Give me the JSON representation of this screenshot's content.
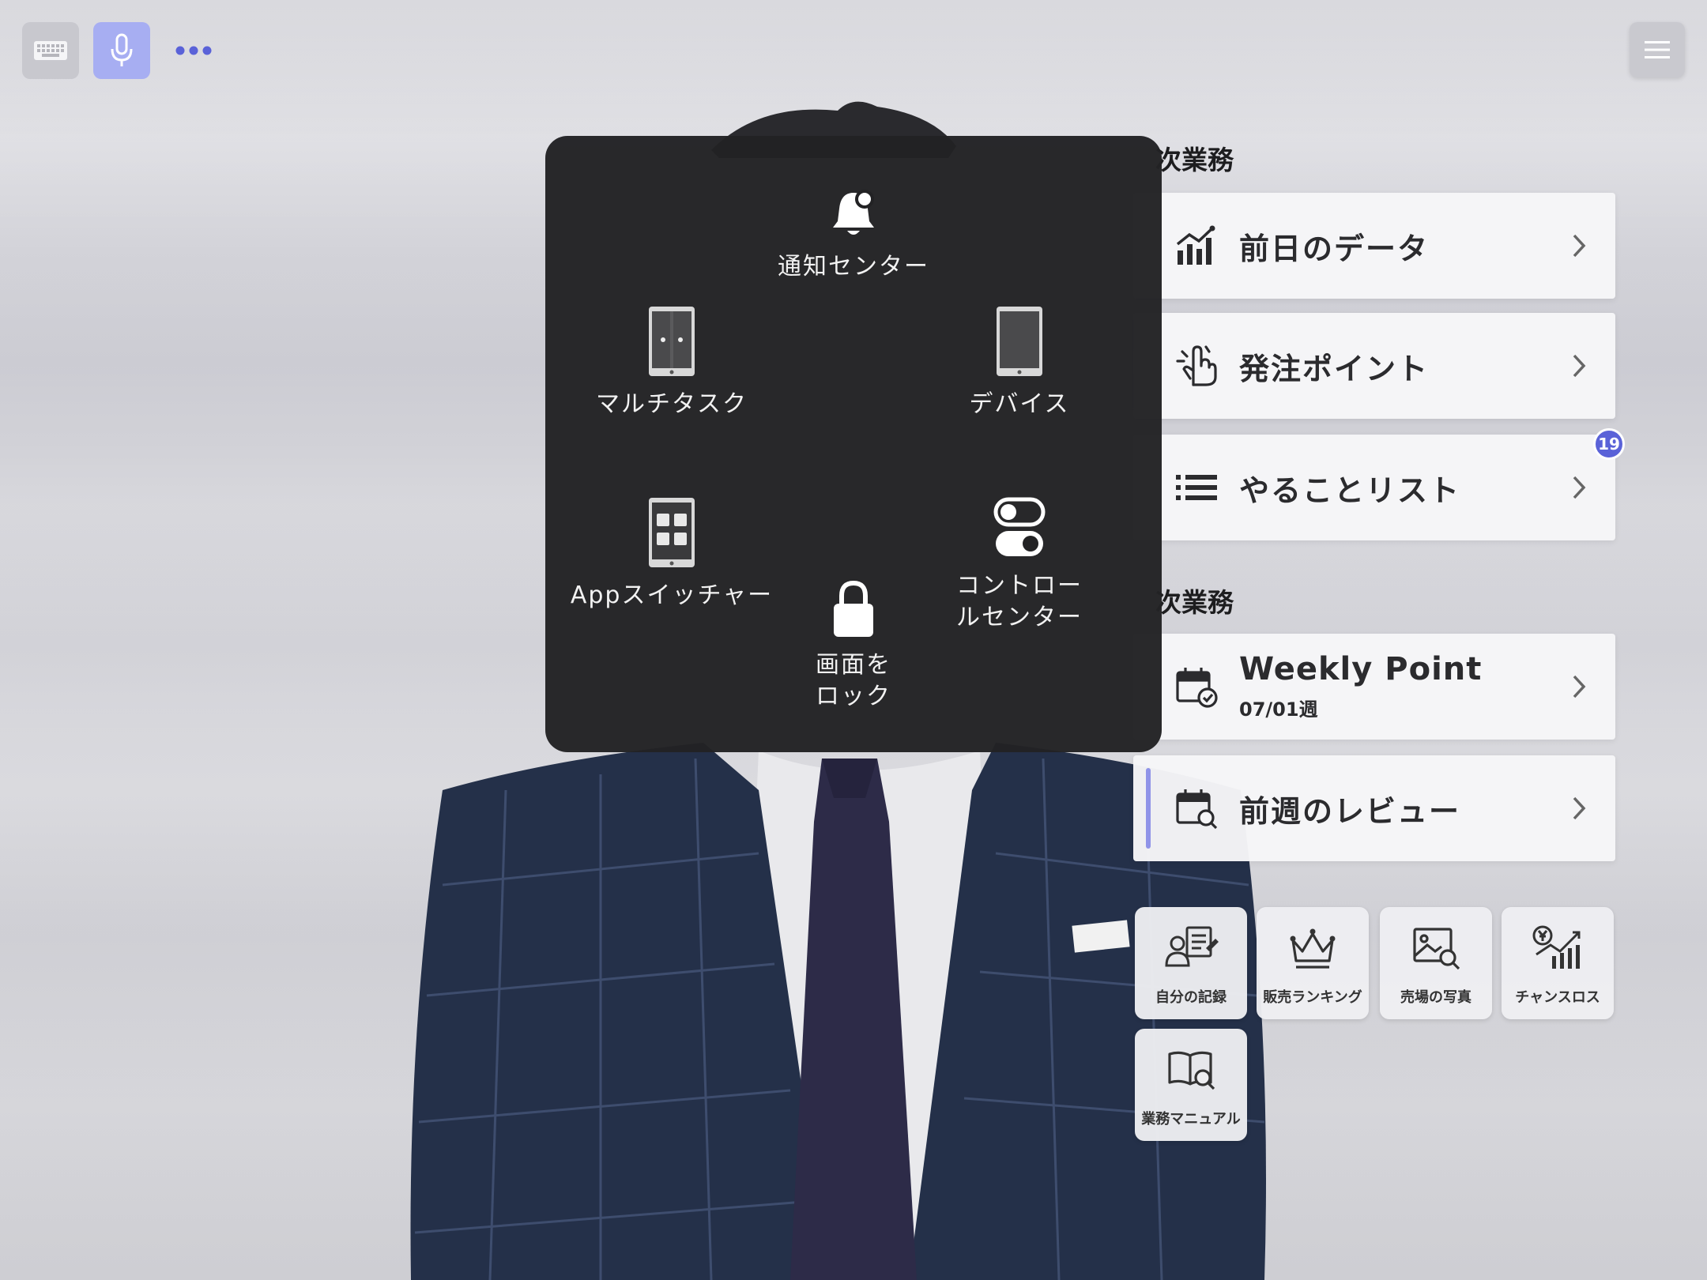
{
  "topbar": {
    "keyboard_icon": "keyboard-icon",
    "mic_icon": "microphone-icon",
    "more_icon": "ellipsis-icon",
    "menu_icon": "hamburger-icon"
  },
  "assistive_menu": {
    "items": [
      {
        "label": "通知センター",
        "icon": "bell-icon"
      },
      {
        "label": "マルチタスク",
        "icon": "multitask-icon"
      },
      {
        "label": "デバイス",
        "icon": "device-icon"
      },
      {
        "label": "Appスイッチャー",
        "icon": "app-switcher-icon"
      },
      {
        "label": "画面を\nロック",
        "icon": "lock-icon"
      },
      {
        "label": "コントロー\nルセンター",
        "icon": "toggles-icon"
      }
    ]
  },
  "sections": [
    {
      "title": "次業務"
    },
    {
      "title": "次業務"
    }
  ],
  "cards": [
    {
      "label": "前日のデータ",
      "icon": "bar-chart-icon"
    },
    {
      "label": "発注ポイント",
      "icon": "pointing-hand-icon"
    },
    {
      "label": "やることリスト",
      "icon": "list-icon",
      "badge": "19"
    },
    {
      "label": "Weekly Point",
      "sub": "07/01週",
      "icon": "calendar-check-icon"
    },
    {
      "label": "前週のレビュー",
      "icon": "calendar-search-icon"
    }
  ],
  "tiles": [
    {
      "label": "自分の記録",
      "icon": "user-notes-icon"
    },
    {
      "label": "販売ランキング",
      "icon": "crown-icon"
    },
    {
      "label": "売場の写真",
      "icon": "photo-search-icon"
    },
    {
      "label": "チャンスロス",
      "icon": "yen-chart-icon"
    },
    {
      "label": "業務マニュアル",
      "icon": "book-search-icon"
    }
  ],
  "colors": {
    "accent": "#5a62d8",
    "mic_bg": "#a7aef2",
    "menu_bg": "#222224"
  }
}
